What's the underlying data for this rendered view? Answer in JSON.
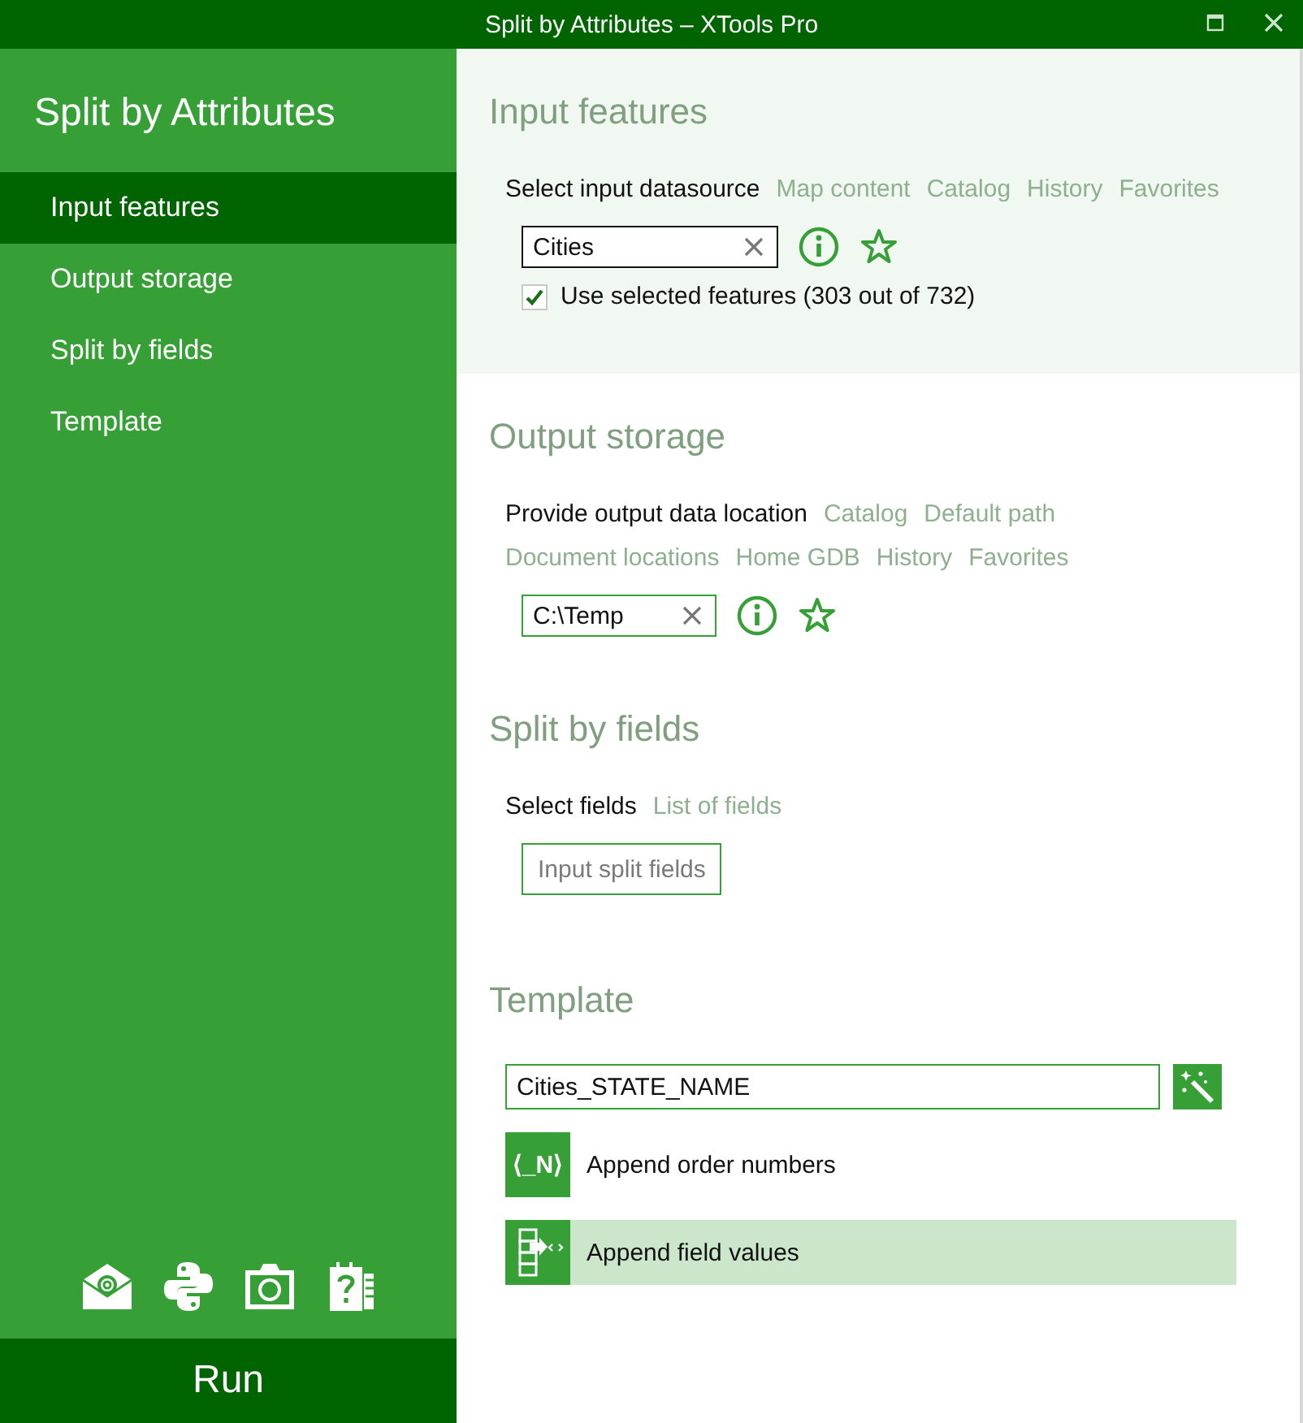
{
  "window": {
    "title": "Split by Attributes – XTools Pro"
  },
  "sidebar": {
    "title": "Split by Attributes",
    "items": [
      {
        "label": "Input features",
        "selected": true
      },
      {
        "label": "Output storage",
        "selected": false
      },
      {
        "label": "Split by fields",
        "selected": false
      },
      {
        "label": "Template",
        "selected": false
      }
    ],
    "run_button": "Run"
  },
  "input_features": {
    "title": "Input features",
    "prompt": "Select input datasource",
    "links": [
      "Map content",
      "Catalog",
      "History",
      "Favorites"
    ],
    "field_value": "Cities",
    "use_selected": {
      "label": "Use selected features (303 out of 732)",
      "checked": true
    }
  },
  "output_storage": {
    "title": "Output storage",
    "prompt": "Provide output data location",
    "links": [
      "Catalog",
      "Default path",
      "Document locations",
      "Home GDB",
      "History",
      "Favorites"
    ],
    "field_value": "C:\\Temp"
  },
  "split_by_fields": {
    "title": "Split by fields",
    "prompt": "Select fields",
    "links": [
      "List of fields"
    ],
    "button": "Input split fields"
  },
  "template": {
    "title": "Template",
    "field_value": "Cities_STATE_NAME",
    "options": [
      {
        "kind": "order-numbers",
        "icon_text": "⟨_N⟩",
        "label": "Append order numbers",
        "selected": false
      },
      {
        "kind": "field-values",
        "label": "Append field values",
        "selected": true
      }
    ]
  }
}
